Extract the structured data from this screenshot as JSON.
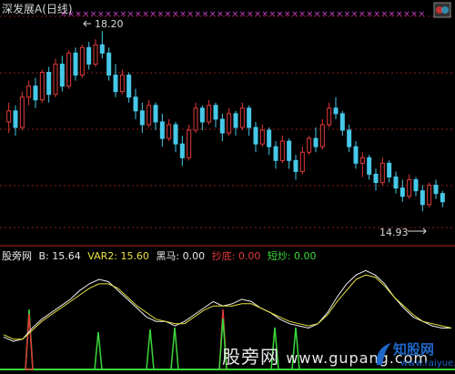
{
  "header": {
    "title": "深发展A(日线)",
    "colors": {
      "up": "#e03a3a",
      "down": "#46c8e8",
      "bg": "#000000",
      "grid": "#8a1a1a"
    }
  },
  "price_labels": {
    "high": "18.20",
    "low": "14.93"
  },
  "indicator": {
    "name": "股旁网",
    "items": [
      {
        "label": "B: 15.64",
        "color": "#e8e8e8"
      },
      {
        "label": "VAR2: 15.60",
        "color": "#e8e040"
      },
      {
        "label": "黑马: 0.00",
        "color": "#e8e8e8"
      },
      {
        "label": "抄底: 0.00",
        "color": "#e03a3a"
      },
      {
        "label": "短炒: 0.00",
        "color": "#3ad83a"
      }
    ]
  },
  "watermark": {
    "main": "股旁网 ",
    "url": "www.gupang.com"
  },
  "brand": {
    "name": "知股网",
    "url": "www.raiyue.com"
  },
  "icons": {
    "logo": "logo-icon"
  },
  "chart_data": [
    {
      "type": "candlestick",
      "title": "深发展A(日线)",
      "high_annotation": 18.2,
      "low_annotation": 14.93,
      "ylim": [
        14.6,
        18.4
      ],
      "ohlc": [
        [
          16.55,
          16.9,
          16.35,
          16.75
        ],
        [
          16.75,
          16.85,
          16.3,
          16.45
        ],
        [
          16.45,
          17.1,
          16.4,
          17.0
        ],
        [
          17.0,
          17.3,
          16.85,
          17.2
        ],
        [
          17.2,
          17.35,
          16.8,
          16.95
        ],
        [
          16.95,
          17.5,
          16.9,
          17.45
        ],
        [
          17.45,
          17.55,
          16.9,
          17.05
        ],
        [
          17.05,
          17.7,
          17.0,
          17.6
        ],
        [
          17.6,
          17.75,
          17.1,
          17.2
        ],
        [
          17.2,
          17.85,
          17.15,
          17.8
        ],
        [
          17.8,
          17.9,
          17.3,
          17.4
        ],
        [
          17.4,
          17.95,
          17.35,
          17.9
        ],
        [
          17.9,
          18.0,
          17.5,
          17.6
        ],
        [
          17.6,
          18.05,
          17.55,
          17.95
        ],
        [
          17.95,
          18.2,
          17.7,
          17.8
        ],
        [
          17.8,
          17.9,
          17.3,
          17.4
        ],
        [
          17.4,
          17.6,
          17.0,
          17.1
        ],
        [
          17.1,
          17.5,
          17.05,
          17.4
        ],
        [
          17.4,
          17.45,
          16.9,
          17.0
        ],
        [
          17.0,
          17.15,
          16.6,
          16.75
        ],
        [
          16.75,
          16.9,
          16.35,
          16.5
        ],
        [
          16.5,
          16.95,
          16.45,
          16.85
        ],
        [
          16.85,
          16.9,
          16.4,
          16.55
        ],
        [
          16.55,
          16.7,
          16.1,
          16.25
        ],
        [
          16.25,
          16.6,
          16.2,
          16.5
        ],
        [
          16.5,
          16.55,
          16.0,
          16.15
        ],
        [
          16.15,
          16.3,
          15.75,
          15.9
        ],
        [
          15.9,
          16.5,
          15.85,
          16.4
        ],
        [
          16.4,
          16.9,
          16.35,
          16.8
        ],
        [
          16.8,
          16.85,
          16.4,
          16.55
        ],
        [
          16.55,
          16.95,
          16.5,
          16.85
        ],
        [
          16.85,
          16.9,
          16.45,
          16.6
        ],
        [
          16.6,
          16.7,
          16.2,
          16.35
        ],
        [
          16.35,
          16.8,
          16.3,
          16.7
        ],
        [
          16.7,
          16.75,
          16.3,
          16.45
        ],
        [
          16.45,
          16.9,
          16.4,
          16.8
        ],
        [
          16.8,
          16.85,
          16.3,
          16.45
        ],
        [
          16.45,
          16.55,
          16.0,
          16.15
        ],
        [
          16.15,
          16.5,
          16.1,
          16.4
        ],
        [
          16.4,
          16.45,
          15.95,
          16.1
        ],
        [
          16.1,
          16.2,
          15.7,
          15.85
        ],
        [
          15.85,
          16.3,
          15.8,
          16.2
        ],
        [
          16.2,
          16.25,
          15.7,
          15.85
        ],
        [
          15.85,
          15.95,
          15.5,
          15.65
        ],
        [
          15.65,
          16.1,
          15.6,
          16.0
        ],
        [
          16.0,
          16.3,
          15.95,
          16.25
        ],
        [
          16.25,
          16.45,
          16.0,
          16.1
        ],
        [
          16.1,
          16.6,
          16.05,
          16.5
        ],
        [
          16.5,
          16.9,
          16.45,
          16.8
        ],
        [
          16.8,
          17.0,
          16.6,
          16.7
        ],
        [
          16.7,
          16.75,
          16.3,
          16.4
        ],
        [
          16.4,
          16.5,
          16.0,
          16.1
        ],
        [
          16.1,
          16.2,
          15.7,
          15.8
        ],
        [
          15.8,
          16.0,
          15.55,
          15.9
        ],
        [
          15.9,
          15.95,
          15.5,
          15.6
        ],
        [
          15.6,
          15.7,
          15.3,
          15.45
        ],
        [
          15.45,
          15.9,
          15.4,
          15.8
        ],
        [
          15.8,
          15.85,
          15.45,
          15.55
        ],
        [
          15.55,
          15.65,
          15.25,
          15.35
        ],
        [
          15.35,
          15.5,
          15.1,
          15.2
        ],
        [
          15.2,
          15.6,
          15.15,
          15.5
        ],
        [
          15.5,
          15.55,
          15.2,
          15.3
        ],
        [
          15.3,
          15.4,
          14.93,
          15.05
        ],
        [
          15.05,
          15.45,
          15.0,
          15.4
        ],
        [
          15.4,
          15.5,
          15.15,
          15.25
        ],
        [
          15.25,
          15.3,
          15.0,
          15.1
        ]
      ]
    },
    {
      "type": "line",
      "series": [
        {
          "name": "B",
          "values": [
            15.2,
            15.0,
            15.1,
            15.6,
            16.0,
            16.3,
            16.6,
            16.9,
            17.3,
            17.6,
            17.8,
            17.7,
            17.3,
            16.9,
            16.5,
            16.1,
            15.9,
            15.9,
            15.7,
            15.9,
            16.2,
            16.5,
            16.8,
            16.6,
            16.7,
            16.9,
            16.8,
            16.5,
            16.3,
            16.0,
            15.8,
            15.7,
            15.6,
            15.8,
            16.3,
            17.0,
            17.6,
            18.0,
            18.2,
            18.0,
            17.6,
            17.0,
            16.5,
            16.1,
            15.9,
            15.7,
            15.6,
            15.6
          ]
        },
        {
          "name": "VAR2",
          "values": [
            15.3,
            15.1,
            15.1,
            15.5,
            15.9,
            16.2,
            16.5,
            16.8,
            17.1,
            17.4,
            17.6,
            17.6,
            17.4,
            17.0,
            16.6,
            16.3,
            16.0,
            15.9,
            15.8,
            15.8,
            16.1,
            16.4,
            16.6,
            16.6,
            16.6,
            16.7,
            16.7,
            16.5,
            16.3,
            16.1,
            15.9,
            15.8,
            15.7,
            15.8,
            16.2,
            16.8,
            17.3,
            17.8,
            18.0,
            17.9,
            17.5,
            17.0,
            16.6,
            16.2,
            15.9,
            15.8,
            15.7,
            15.6
          ]
        }
      ]
    }
  ]
}
